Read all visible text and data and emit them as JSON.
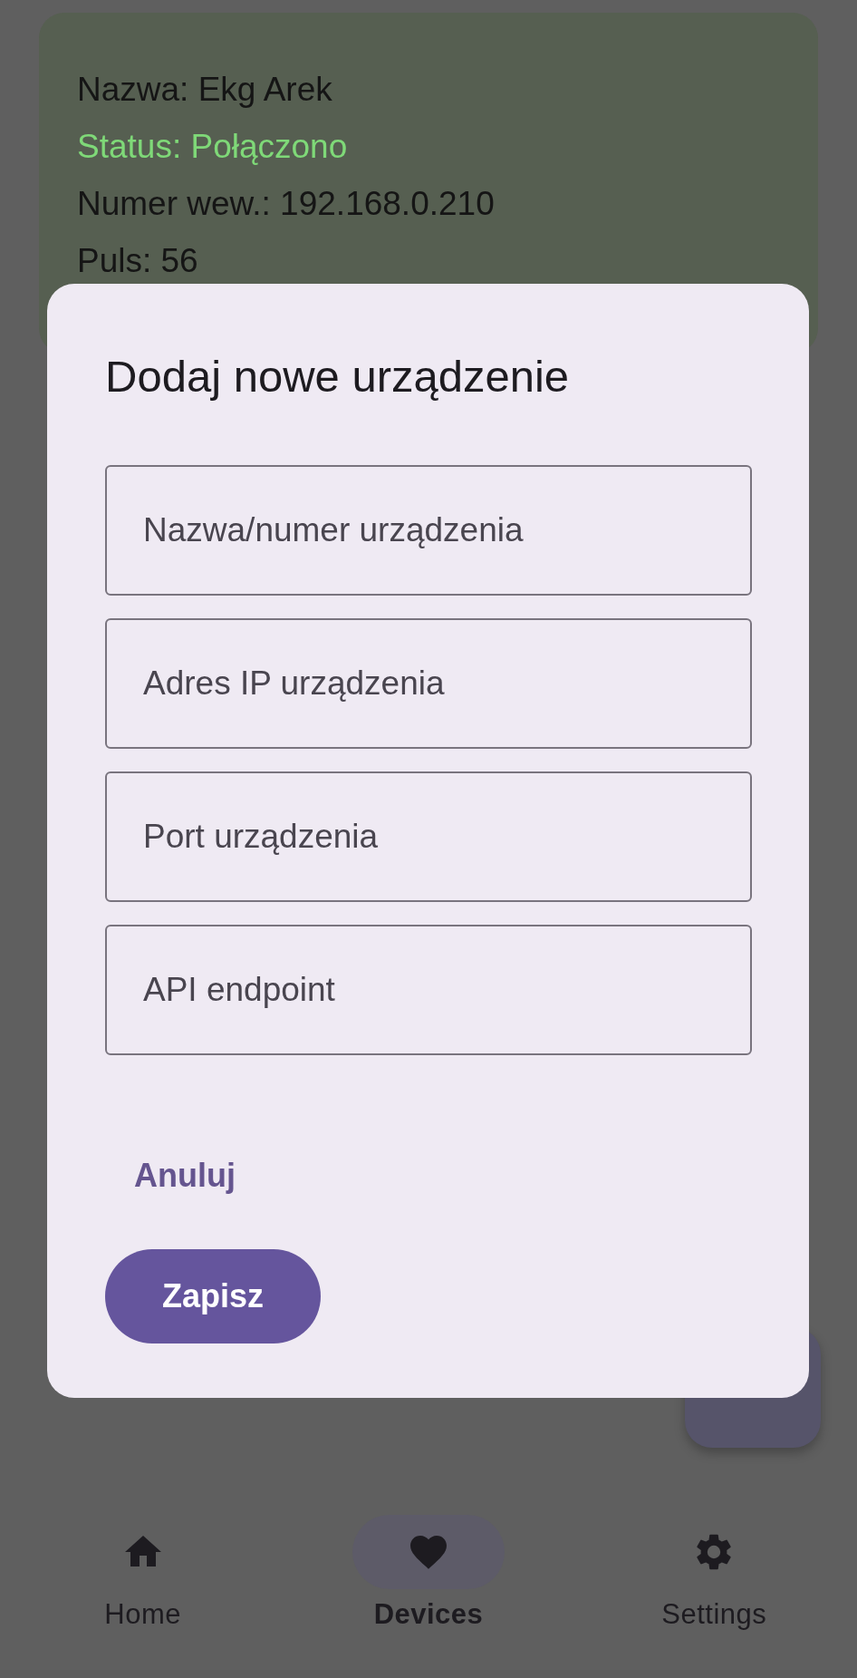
{
  "device_card": {
    "lines": [
      {
        "text": "Nazwa: Ekg Arek",
        "kind": "plain"
      },
      {
        "text": "Status: Połączono",
        "kind": "status"
      },
      {
        "text": "Numer wew.: 192.168.0.210",
        "kind": "plain"
      },
      {
        "text": "Puls: 56",
        "kind": "plain"
      }
    ]
  },
  "dialog": {
    "title": "Dodaj nowe urządzenie",
    "fields": [
      {
        "placeholder": "Nazwa/numer urządzenia"
      },
      {
        "placeholder": "Adres IP urządzenia"
      },
      {
        "placeholder": "Port urządzenia"
      },
      {
        "placeholder": "API endpoint"
      }
    ],
    "cancel_button": "Anuluj",
    "save_button": "Zapisz"
  },
  "bottom_nav": [
    {
      "label": "Home",
      "kind": "home",
      "selected": false
    },
    {
      "label": "Devices",
      "kind": "heart",
      "selected": true
    },
    {
      "label": "Settings",
      "kind": "gear",
      "selected": false
    }
  ]
}
